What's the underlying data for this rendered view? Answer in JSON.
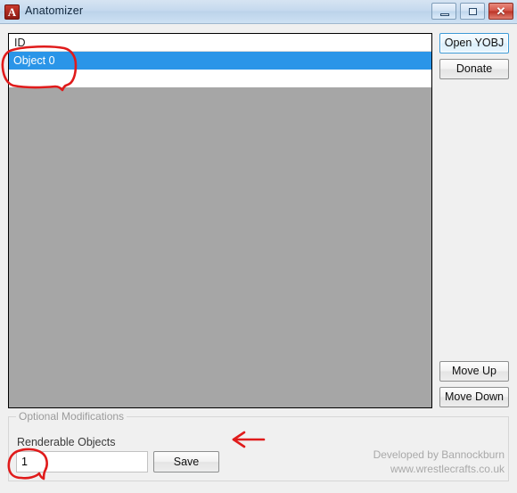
{
  "window": {
    "title": "Anatomizer",
    "app_icon": "anatomizer-logo-icon",
    "icon_letter": "A",
    "controls": {
      "minimize_label": "–",
      "maximize_label": "□",
      "close_label": "✕"
    }
  },
  "listview": {
    "columns": [
      "ID"
    ],
    "rows": [
      {
        "id": "Object 0",
        "selected": true
      },
      {
        "id": "",
        "selected": false
      }
    ],
    "selection_color": "#2a95e8",
    "empty_area_color": "#a6a6a6"
  },
  "side_buttons": [
    {
      "label": "Open YOBJ",
      "focused": true
    },
    {
      "label": "Donate",
      "focused": false
    },
    {
      "label": "Move Up",
      "focused": false
    },
    {
      "label": "Move Down",
      "focused": false
    }
  ],
  "group_box": {
    "label": "Optional Modifications",
    "field_label": "Renderable Objects",
    "field_value": "1",
    "field_placeholder": "",
    "save_label": "Save"
  },
  "credits": {
    "line1": "Developed by Bannockburn",
    "line2": "www.wrestlecrafts.co.uk"
  },
  "annotations": {
    "circle_object_row": "red-circle-around-object-0",
    "circle_input": "red-circle-around-renderable-objects-input",
    "arrow_save": "red-arrow-pointing-left-at-save-button",
    "color": "#e01b1b"
  }
}
